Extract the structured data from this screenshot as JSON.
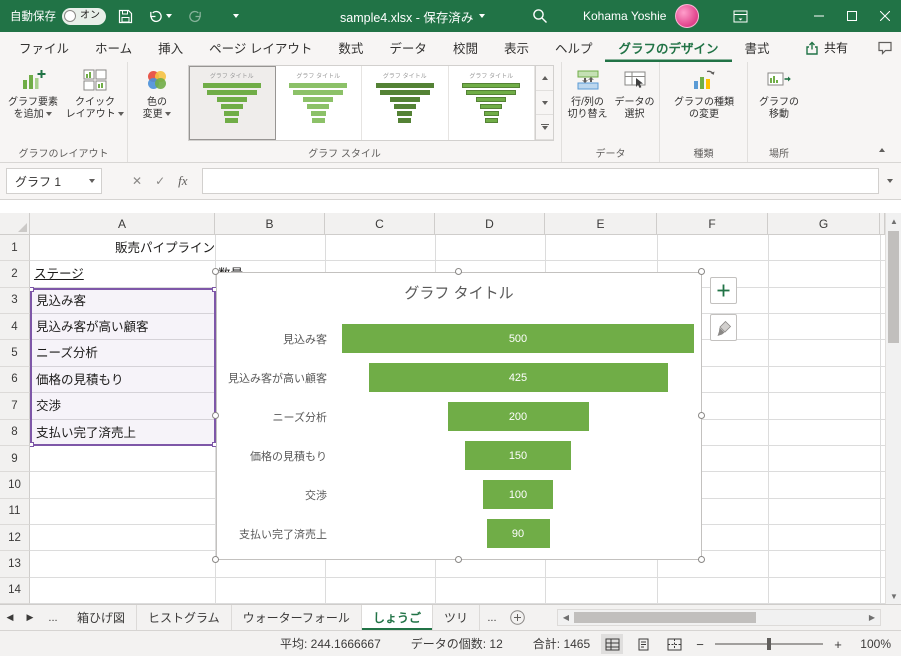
{
  "accent": {
    "excel_green": "#217346",
    "bar_green": "#70AD47",
    "range_purple": "#7E57A8"
  },
  "titlebar": {
    "autosave_label": "自動保存",
    "autosave_state": "オン",
    "doc_title": "sample4.xlsx - 保存済み",
    "user_name": "Kohama Yoshie"
  },
  "ribbon_tabs": {
    "items": [
      "ファイル",
      "ホーム",
      "挿入",
      "ページ レイアウト",
      "数式",
      "データ",
      "校閲",
      "表示",
      "ヘルプ",
      "グラフのデザイン",
      "書式"
    ],
    "active": "グラフのデザイン",
    "share_label": "共有"
  },
  "ribbon": {
    "add_element": [
      "グラフ要素",
      "を追加"
    ],
    "quick_layout": [
      "クイック",
      "レイアウト"
    ],
    "change_colors": [
      "色の",
      "変更"
    ],
    "switch_row_col": [
      "行/列の",
      "切り替え"
    ],
    "select_data": [
      "データの",
      "選択"
    ],
    "change_type": [
      "グラフの種類",
      "の変更"
    ],
    "move_chart": [
      "グラフの",
      "移動"
    ],
    "thumb_title": "グラフ タイトル",
    "groups": {
      "layout": "グラフのレイアウト",
      "styles": "グラフ スタイル",
      "data": "データ",
      "type": "種類",
      "location": "場所"
    }
  },
  "formula_bar": {
    "name_box": "グラフ 1",
    "fx": "fx",
    "formula": "",
    "cancel": "✕",
    "enter": "✓"
  },
  "grid": {
    "columns": [
      "A",
      "B",
      "C",
      "D",
      "E",
      "F",
      "G"
    ],
    "row_numbers": [
      "1",
      "2",
      "3",
      "4",
      "5",
      "6",
      "7",
      "8",
      "9",
      "10",
      "11",
      "12",
      "13",
      "14"
    ],
    "cells": {
      "a1": "販売パイプライン",
      "a2": "ステージ",
      "b2": "数量",
      "a3": "見込み客",
      "a4": "見込み客が高い顧客",
      "a5": "ニーズ分析",
      "a6": "価格の見積もり",
      "a7": "交渉",
      "a8": "支払い完了済売上"
    }
  },
  "chart_data": {
    "type": "funnel",
    "title": "グラフ タイトル",
    "categories": [
      "見込み客",
      "見込み客が高い顧客",
      "ニーズ分析",
      "価格の見積もり",
      "交渉",
      "支払い完了済売上"
    ],
    "values": [
      500,
      425,
      200,
      150,
      100,
      90
    ],
    "max_value": 500,
    "bar_color": "#70AD47",
    "legend": "none",
    "data_labels": "inside"
  },
  "sheet_tabs": {
    "items": [
      "箱ひげ図",
      "ヒストグラム",
      "ウォーターフォール",
      "しょうご",
      "ツリ"
    ],
    "active": "しょうご",
    "overflow_left": "...",
    "overflow_right": "..."
  },
  "status_bar": {
    "average": "平均: 244.1666667",
    "count": "データの個数: 12",
    "sum": "合計: 1465",
    "zoom": "100%",
    "zoom_out": "−",
    "zoom_in": "+"
  }
}
